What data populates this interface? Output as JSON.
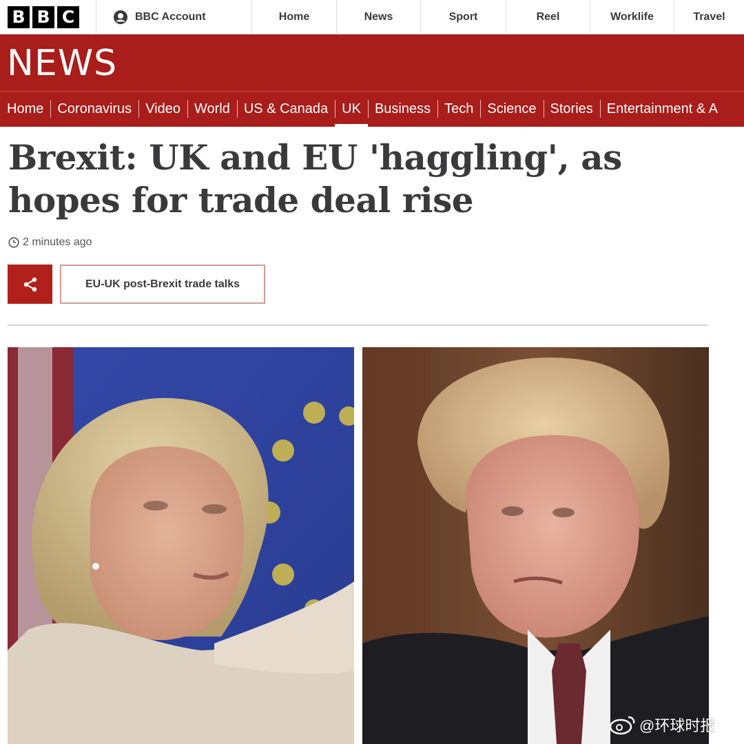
{
  "global_nav": {
    "logo_letters": [
      "B",
      "B",
      "C"
    ],
    "account_label": "BBC Account",
    "items": [
      "Home",
      "News",
      "Sport",
      "Reel",
      "Worklife",
      "Travel"
    ]
  },
  "news_header": {
    "title": "NEWS",
    "nav": [
      "Home",
      "Coronavirus",
      "Video",
      "World",
      "US & Canada",
      "UK",
      "Business",
      "Tech",
      "Science",
      "Stories",
      "Entertainment & A"
    ],
    "active_item": "UK"
  },
  "article": {
    "headline": "Brexit: UK and EU 'haggling', as hopes for trade deal rise",
    "timestamp": "2 minutes ago",
    "topic_tag": "EU-UK post-Brexit trade talks"
  },
  "watermark": {
    "text": "@环球时报"
  },
  "colors": {
    "news_red": "#a91d1a",
    "share_red": "#b1201b",
    "tag_border": "#d49a98"
  }
}
